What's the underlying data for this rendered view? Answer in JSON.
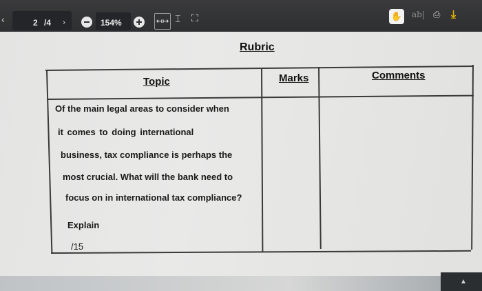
{
  "toolbar": {
    "back_icon": "chevron-left-icon",
    "page_current": "2",
    "page_total": "/4",
    "next_icon": "chevron-right-icon",
    "zoom": "154%",
    "zoom_out_icon": "minus-circle-icon",
    "zoom_in_icon": "plus-circle-icon",
    "fit_width_icon": "fit-width-icon",
    "fit_page_icon": "fit-page-icon",
    "fullscreen_icon": "fullscreen-icon",
    "hand_icon": "hand-tool-icon",
    "text_select_label": "ab|",
    "print_icon": "print-icon",
    "download_icon": "download-icon"
  },
  "document": {
    "title": "Rubric",
    "headers": {
      "topic": "Topic",
      "marks": "Marks",
      "comments": "Comments"
    },
    "question_lines": [
      "Of the main legal areas to consider when",
      "it      comes      to      doing      international",
      "business, tax compliance is perhaps the",
      "most crucial. What will the bank need to",
      "focus on in international tax compliance?",
      "Explain",
      "/15"
    ],
    "marks_value": "",
    "comments_value": ""
  },
  "colors": {
    "toolbar": "#2e2f31",
    "accent_download": "#e6b400",
    "page": "#e6e6e5"
  }
}
